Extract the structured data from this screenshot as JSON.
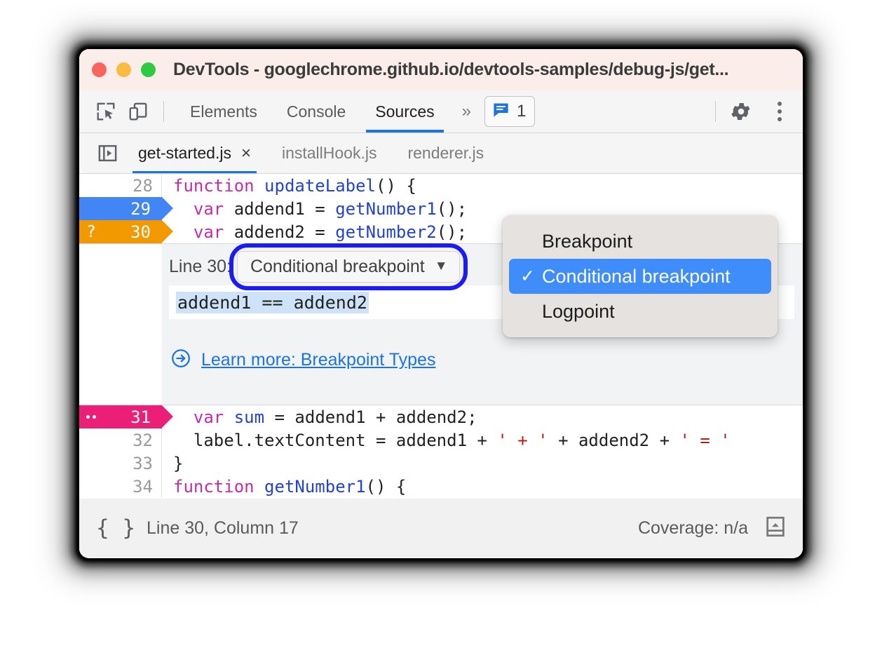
{
  "window": {
    "title": "DevTools - googlechrome.github.io/devtools-samples/debug-js/get...",
    "traffic_lights": [
      "close-red",
      "minimize-yellow",
      "maximize-green"
    ]
  },
  "toolbar": {
    "inspect_icon": "inspect-element-icon",
    "device_icon": "device-toolbar-icon",
    "panels": [
      {
        "label": "Elements",
        "active": false
      },
      {
        "label": "Console",
        "active": false
      },
      {
        "label": "Sources",
        "active": true
      }
    ],
    "more_panels": "»",
    "message_count": "1",
    "message_icon": "console-message-icon",
    "settings_icon": "gear-icon",
    "menu_icon": "kebab-menu-icon"
  },
  "file_tabs": {
    "nav_toggle_icon": "show-navigator-icon",
    "tabs": [
      {
        "label": "get-started.js",
        "active": true,
        "close": "×"
      },
      {
        "label": "installHook.js",
        "active": false
      },
      {
        "label": "renderer.js",
        "active": false
      }
    ]
  },
  "editor": {
    "lines": [
      {
        "number": "28",
        "marker": "none",
        "tokens": [
          {
            "t": "function",
            "c": "kw"
          },
          {
            "t": " ",
            "c": "pln"
          },
          {
            "t": "updateLabel",
            "c": "fn"
          },
          {
            "t": "() {",
            "c": "pln"
          }
        ]
      },
      {
        "number": "29",
        "marker": "breakpoint",
        "marker_color": "#4285f4",
        "marker_glyph": "",
        "tokens": [
          {
            "t": "  ",
            "c": "pln"
          },
          {
            "t": "var",
            "c": "kw"
          },
          {
            "t": " addend1 = ",
            "c": "pln"
          },
          {
            "t": "getNumber1",
            "c": "fn"
          },
          {
            "t": "();",
            "c": "pln"
          }
        ]
      },
      {
        "number": "30",
        "marker": "conditional-breakpoint",
        "marker_color": "#f29900",
        "marker_glyph": "?",
        "tokens": [
          {
            "t": "  ",
            "c": "pln"
          },
          {
            "t": "var",
            "c": "kw"
          },
          {
            "t": " addend2 = ",
            "c": "pln"
          },
          {
            "t": "getNumber2",
            "c": "fn"
          },
          {
            "t": "();",
            "c": "pln"
          }
        ]
      },
      {
        "number": "31",
        "marker": "logpoint",
        "marker_color": "#ec1f78",
        "marker_glyph": "..",
        "tokens": [
          {
            "t": "  ",
            "c": "pln"
          },
          {
            "t": "var",
            "c": "kw"
          },
          {
            "t": " ",
            "c": "pln"
          },
          {
            "t": "sum",
            "c": "fn"
          },
          {
            "t": " = addend1 + addend2;",
            "c": "pln"
          }
        ]
      },
      {
        "number": "32",
        "marker": "none",
        "tokens": [
          {
            "t": "  label.textContent = addend1 + ",
            "c": "pln"
          },
          {
            "t": "' + '",
            "c": "str"
          },
          {
            "t": " + addend2 + ",
            "c": "pln"
          },
          {
            "t": "' = '",
            "c": "str"
          }
        ]
      },
      {
        "number": "33",
        "marker": "none",
        "tokens": [
          {
            "t": "}",
            "c": "pln"
          }
        ]
      },
      {
        "number": "34",
        "marker": "none",
        "tokens": [
          {
            "t": "function",
            "c": "kw"
          },
          {
            "t": " ",
            "c": "pln"
          },
          {
            "t": "getNumber1",
            "c": "fn"
          },
          {
            "t": "() {",
            "c": "pln"
          }
        ]
      }
    ]
  },
  "breakpoint_panel": {
    "line_label": "Line 30:",
    "selected_type": "Conditional breakpoint",
    "caret": "▼",
    "condition_value": "addend1 == addend2",
    "learn_more_icon": "arrow-circle-right-icon",
    "learn_more_label": "Learn more: Breakpoint Types",
    "highlight_color": "#1b1bf5"
  },
  "dropdown_menu": {
    "items": [
      {
        "label": "Breakpoint",
        "selected": false
      },
      {
        "label": "Conditional breakpoint",
        "selected": true,
        "check": "✓"
      },
      {
        "label": "Logpoint",
        "selected": false
      }
    ],
    "selected_color": "#3f8cfb"
  },
  "statusbar": {
    "format_icon": "pretty-print-braces-icon",
    "position": "Line 30, Column 17",
    "coverage": "Coverage: n/a",
    "drawer_icon": "show-drawer-icon"
  }
}
